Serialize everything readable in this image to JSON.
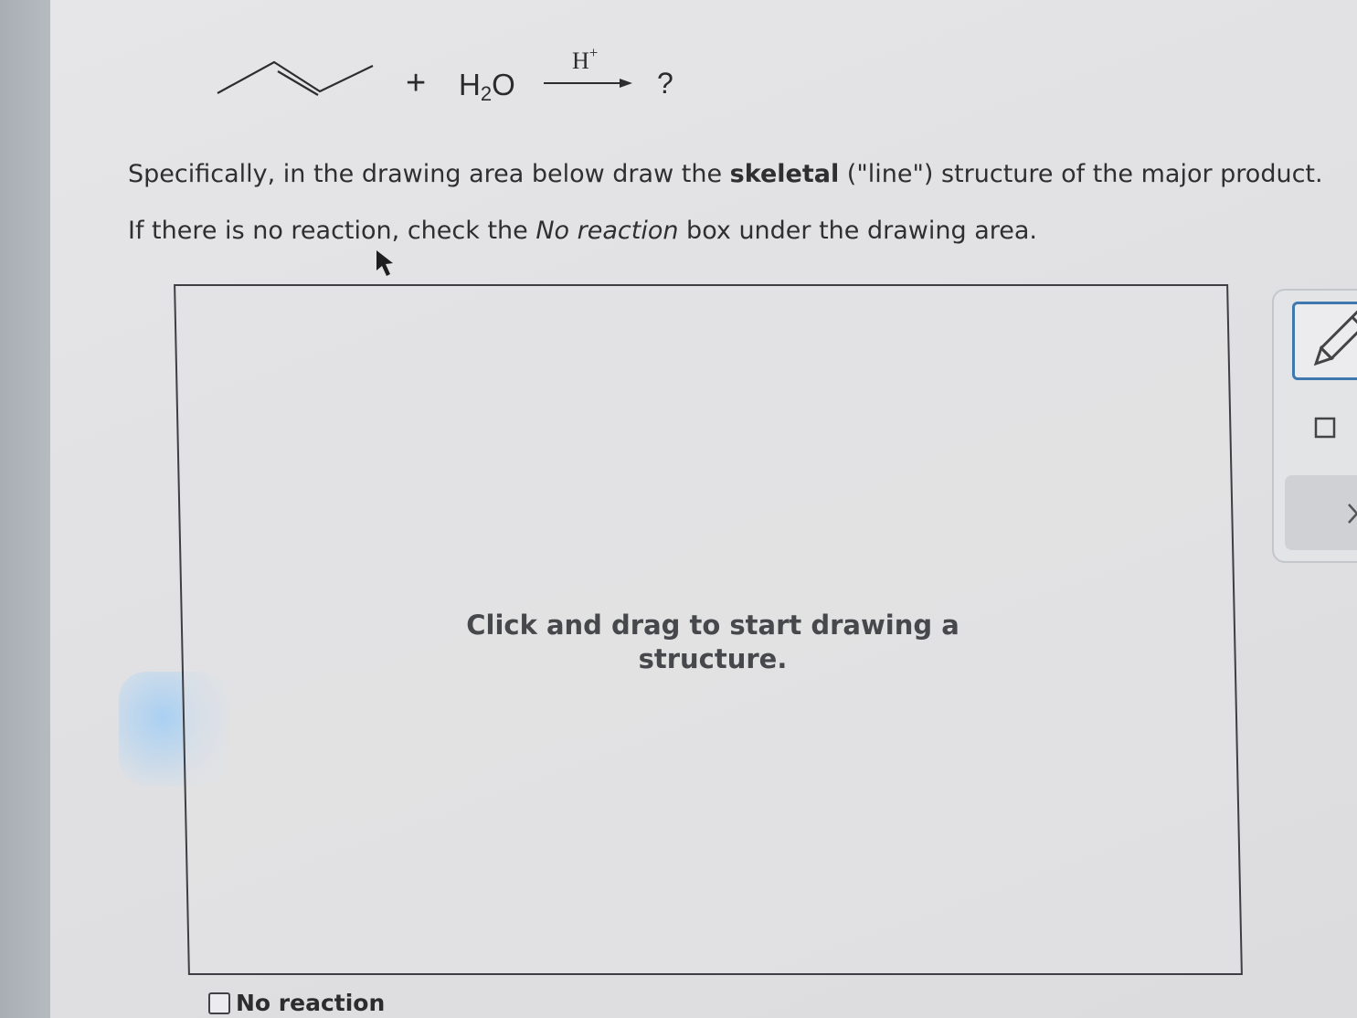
{
  "reaction": {
    "plus": "+",
    "water_main": "H",
    "water_sub": "2",
    "water_end": "O",
    "catalyst_base": "H",
    "catalyst_charge": "+",
    "product_placeholder": "?"
  },
  "instructions": {
    "line1_pre": "Specifically, in the drawing area below draw the ",
    "line1_bold": "skeletal",
    "line1_post": " (\"line\") structure of the major product.",
    "line2_pre": "If there is no reaction, check the ",
    "line2_italic": "No reaction",
    "line2_post": " box under the drawing area."
  },
  "drawing_area": {
    "prompt_line1": "Click and drag to start drawing a",
    "prompt_line2": "structure."
  },
  "no_reaction": {
    "label": "No reaction",
    "checked": false
  },
  "toolbar": {
    "tools": [
      "pencil-icon",
      "square-icon",
      "close-icon"
    ],
    "accent_color": "#3f79b0"
  }
}
